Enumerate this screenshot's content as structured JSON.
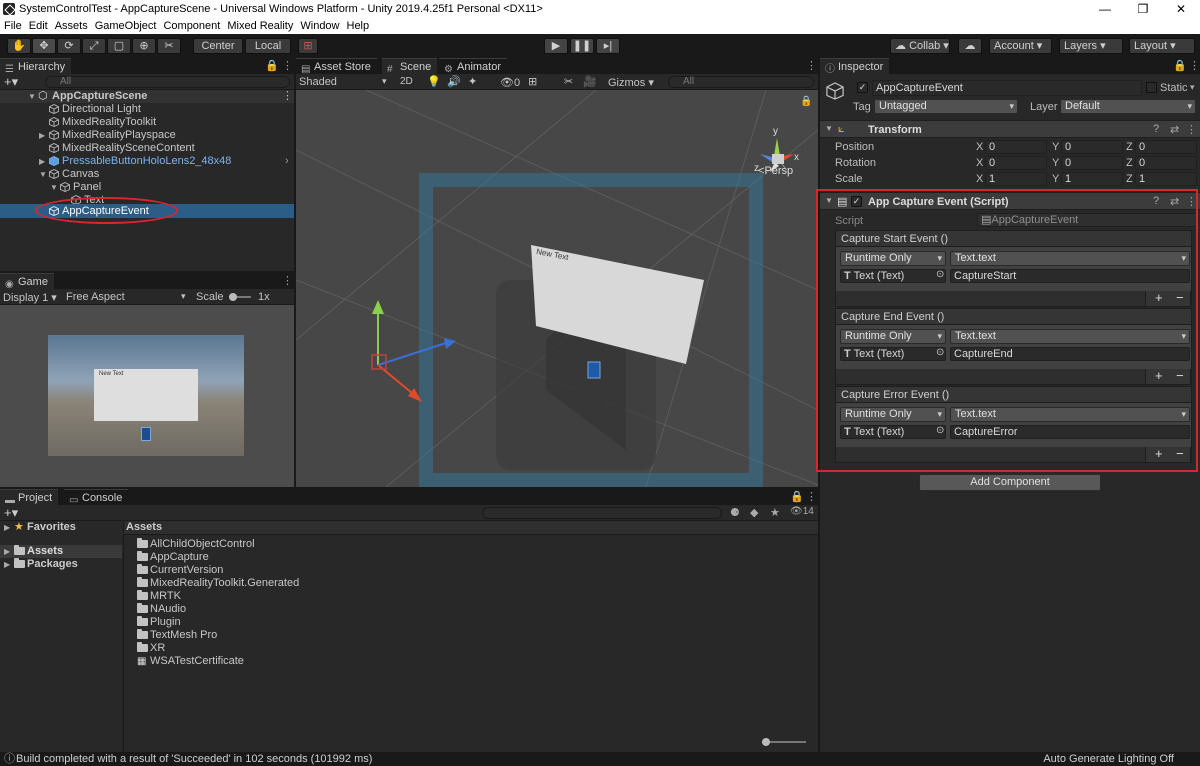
{
  "window": {
    "title": "SystemControlTest - AppCaptureScene - Universal Windows Platform - Unity 2019.4.25f1 Personal <DX11>",
    "minimize": "—",
    "maximize": "❐",
    "close": "✕"
  },
  "menu": [
    "File",
    "Edit",
    "Assets",
    "GameObject",
    "Component",
    "Mixed Reality",
    "Window",
    "Help"
  ],
  "toolbar": {
    "pivot": "Center",
    "space": "Local",
    "collab": "Collab",
    "account": "Account",
    "layers": "Layers",
    "layout": "Layout"
  },
  "hierarchy": {
    "tab": "Hierarchy",
    "search_placeholder": "All",
    "scene": "AppCaptureScene",
    "items": [
      {
        "label": "Directional Light"
      },
      {
        "label": "MixedRealityToolkit"
      },
      {
        "label": "MixedRealityPlayspace"
      },
      {
        "label": "MixedRealitySceneContent"
      },
      {
        "label": "PressableButtonHoloLens2_48x48"
      },
      {
        "label": "Canvas"
      },
      {
        "label": "Panel"
      },
      {
        "label": "Text"
      },
      {
        "label": "AppCaptureEvent"
      }
    ]
  },
  "scene_view": {
    "tabs": [
      "Asset Store",
      "Scene",
      "Animator"
    ],
    "shading": "Shaded",
    "mode_2d": "2D",
    "hidden_count": "0",
    "gizmos": "Gizmos",
    "search_placeholder": "All",
    "persp": "Persp",
    "axis_y": "y",
    "axis_x": "x",
    "axis_z": "z",
    "canvas_text": "New Text"
  },
  "game_view": {
    "tab": "Game",
    "display": "Display 1",
    "aspect": "Free Aspect",
    "scale_label": "Scale",
    "scale_value": "1x",
    "canvas_text": "New Text"
  },
  "inspector": {
    "tab": "Inspector",
    "object_name": "AppCaptureEvent",
    "static_label": "Static",
    "tag_label": "Tag",
    "tag_value": "Untagged",
    "layer_label": "Layer",
    "layer_value": "Default",
    "transform": {
      "title": "Transform",
      "rows": [
        {
          "label": "Position",
          "x": "0",
          "y": "0",
          "z": "0"
        },
        {
          "label": "Rotation",
          "x": "0",
          "y": "0",
          "z": "0"
        },
        {
          "label": "Scale",
          "x": "1",
          "y": "1",
          "z": "1"
        }
      ],
      "axis_x": "X",
      "axis_y": "Y",
      "axis_z": "Z"
    },
    "script_component": {
      "title": "App Capture Event (Script)",
      "script_label": "Script",
      "script_value": "AppCaptureEvent",
      "events": [
        {
          "title": "Capture Start Event ()",
          "runtime": "Runtime Only",
          "function": "Text.text",
          "target": "Text (Text)",
          "value": "CaptureStart"
        },
        {
          "title": "Capture End Event ()",
          "runtime": "Runtime Only",
          "function": "Text.text",
          "target": "Text (Text)",
          "value": "CaptureEnd"
        },
        {
          "title": "Capture Error Event ()",
          "runtime": "Runtime Only",
          "function": "Text.text",
          "target": "Text (Text)",
          "value": "CaptureError"
        }
      ],
      "plus": "+",
      "minus": "−"
    },
    "add_component": "Add Component"
  },
  "project": {
    "tabs": [
      "Project",
      "Console"
    ],
    "favorites": "Favorites",
    "assets": "Assets",
    "packages": "Packages",
    "breadcrumb": "Assets",
    "hidden_count": "14",
    "folders": [
      "AllChildObjectControl",
      "AppCapture",
      "CurrentVersion",
      "MixedRealityToolkit.Generated",
      "MRTK",
      "NAudio",
      "Plugin",
      "TextMesh Pro",
      "XR",
      "WSATestCertificate"
    ]
  },
  "status": {
    "message": "Build completed with a result of 'Succeeded' in 102 seconds (101992 ms)",
    "right": "Auto Generate Lighting Off"
  },
  "colors": {
    "accent_selection": "#2c5d87",
    "annotation_red": "#d8252f",
    "prefab_blue": "#7cb4ef"
  }
}
